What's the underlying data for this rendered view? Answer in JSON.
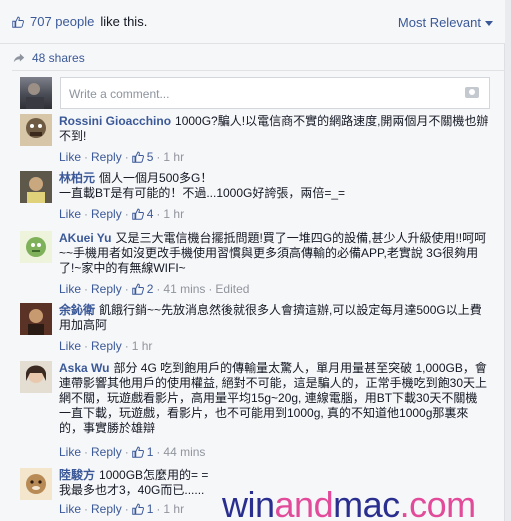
{
  "header": {
    "likes_count": "707 people",
    "likes_suffix": "like this.",
    "sort_label": "Most Relevant"
  },
  "shares": {
    "label": "48 shares"
  },
  "composer": {
    "placeholder": "Write a comment..."
  },
  "comments": [
    {
      "author": "Rossini Gioacchino",
      "text": "1000G?騙人!以電信商不實的網路速度,開兩個月不關機也辦不到!",
      "like": "Like",
      "reply": "Reply",
      "likes": "5",
      "time": "1 hr",
      "edited": ""
    },
    {
      "author": "林柏元",
      "text": "個人一個月500多G！",
      "text2": "一直載BT是有可能的！不過...1000G好誇張，兩倍=_=",
      "like": "Like",
      "reply": "Reply",
      "likes": "4",
      "time": "1 hr",
      "edited": ""
    },
    {
      "author": "AKuei Yu",
      "text": "又是三大電信機台擺抵問題!買了一堆四G的設備,甚少人升級使用!!呵呵~~手機用者如沒更改手機使用習慣與更多須高傳輸的必備APP,老實說 3G很夠用了!~家中的有無線WIFI~",
      "like": "Like",
      "reply": "Reply",
      "likes": "2",
      "time": "41 mins",
      "edited": "Edited"
    },
    {
      "author": "余鈊衛",
      "text": "飢餓行銷~~先放消息然後就很多人會擠這辦,可以設定每月達500G以上費用加高阿",
      "like": "Like",
      "reply": "Reply",
      "likes": "",
      "time": "1 hr",
      "edited": ""
    },
    {
      "author": "Aska Wu",
      "text": "部分 4G 吃到飽用戶的傳輸量太驚人，單月用量甚至突破 1,000GB，會連帶影響其他用戶的使用權益, 絕對不可能，這是騙人的，正常手機吃到飽30天上網不關，玩遊戲看影片，高用量平均15g~20g, 連線電腦，用BT下載30天不關機一直下載，玩遊戲，看影片，也不可能用到1000g, 真的不知道他1000g那裏來的，事實勝於雄辯",
      "like": "Like",
      "reply": "Reply",
      "likes": "1",
      "time": "44 mins",
      "edited": ""
    },
    {
      "author": "陸駿方",
      "text": "1000GB怎麼用的= =",
      "text2": "我最多也才3，40G而已......",
      "like": "Like",
      "reply": "Reply",
      "likes": "1",
      "time": "1 hr",
      "edited": ""
    }
  ],
  "watermark": {
    "part1": "win",
    "part2": "and",
    "part3": "mac",
    "part4": ".com"
  },
  "colors": {
    "link": "#3b5998",
    "meta_grey": "#90949c",
    "panel_bg": "#f6f7f9"
  },
  "icons": [
    "thumbs-up-icon",
    "share-icon",
    "camera-icon",
    "caret-down-icon",
    "avatar"
  ]
}
